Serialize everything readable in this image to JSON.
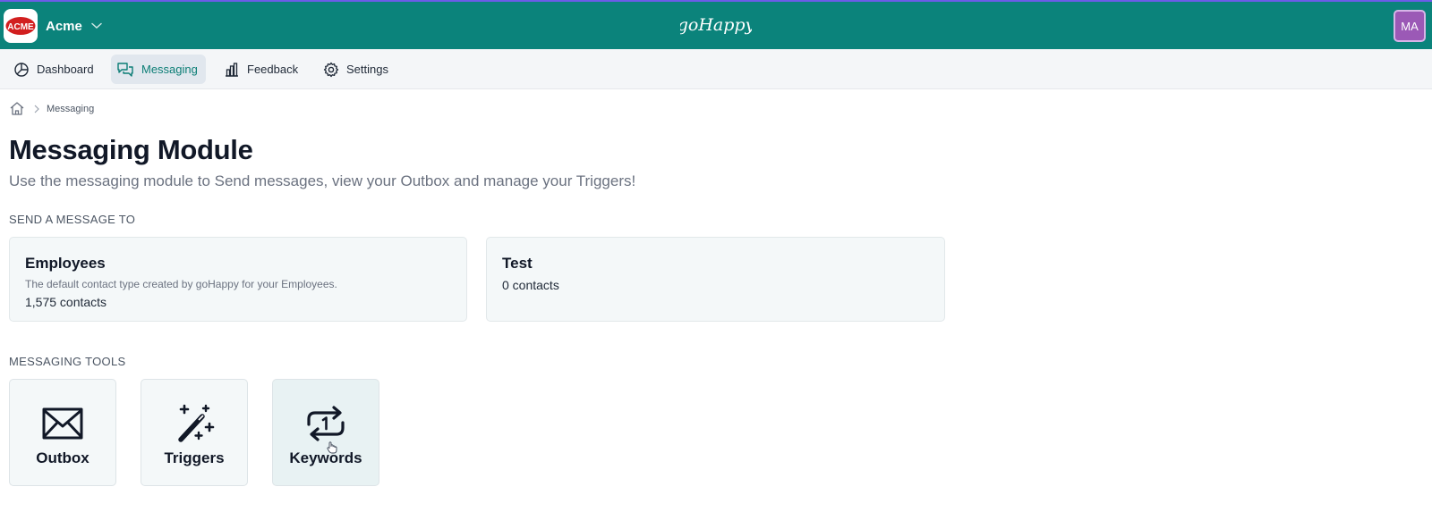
{
  "header": {
    "org_logo_text": "ACME",
    "org_name": "Acme",
    "brand": "goHappy",
    "avatar_initials": "MA",
    "bar_color": "#0b837b"
  },
  "nav": {
    "items": [
      {
        "label": "Dashboard",
        "icon": "pie-chart-icon"
      },
      {
        "label": "Messaging",
        "icon": "chat-bubbles-icon",
        "active": true
      },
      {
        "label": "Feedback",
        "icon": "bar-chart-icon"
      },
      {
        "label": "Settings",
        "icon": "gear-icon"
      }
    ]
  },
  "breadcrumb": {
    "home_icon": "home-icon",
    "current": "Messaging"
  },
  "page": {
    "title": "Messaging Module",
    "subtitle": "Use the messaging module to Send messages, view your Outbox and manage your Triggers!"
  },
  "send_section": {
    "label": "SEND A MESSAGE TO",
    "cards": [
      {
        "name": "Employees",
        "description": "The default contact type created by goHappy for your Employees.",
        "count": "1,575 contacts"
      },
      {
        "name": "Test",
        "count": "0 contacts"
      }
    ]
  },
  "tools_section": {
    "label": "MESSAGING TOOLS",
    "tools": [
      {
        "label": "Outbox",
        "icon": "envelope-icon"
      },
      {
        "label": "Triggers",
        "icon": "magic-wand-icon"
      },
      {
        "label": "Keywords",
        "icon": "repeat-one-icon"
      }
    ]
  }
}
